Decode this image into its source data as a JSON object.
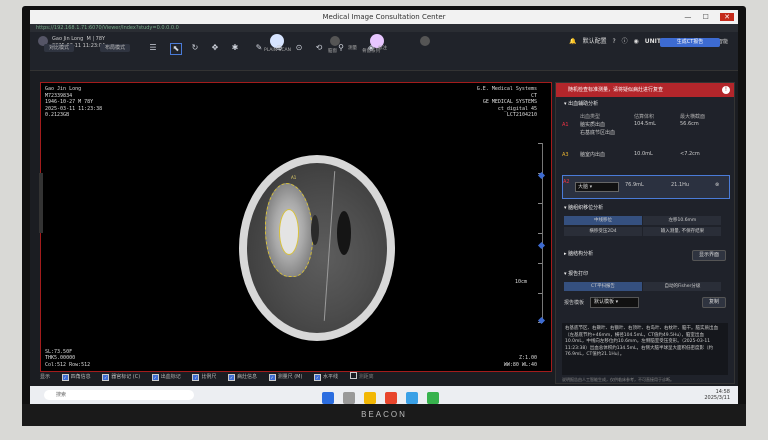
{
  "window": {
    "title": "Medical Image Consultation Center",
    "controls": [
      "—",
      "☐",
      "✕"
    ]
  },
  "address": {
    "url": "https://192.168.1.71:6070/Viewer/Index?study=0.0.0.0.0"
  },
  "patient": {
    "name": "Gao Jin Long",
    "sex_age": "M | 78Y",
    "date": "2025-03-11 11:23:04"
  },
  "series": [
    {
      "label": "PLAIN SCAN",
      "color": "#d6e4ff"
    },
    {
      "label": "脑窗",
      "color": "#555"
    },
    {
      "label": "骨窗系列",
      "color": "#e7c6ff"
    },
    {
      "label": "",
      "color": "#555"
    }
  ],
  "top_right": {
    "notif": "默认配置",
    "brand": "UNITED IMAGING",
    "brand_sub": "联影智能"
  },
  "top_action": "生成CT报告",
  "toolbar": {
    "tab_left": "对比模式",
    "tab_right": "布局模式",
    "tools": [
      {
        "icon": "list-icon",
        "glyph": "☰"
      },
      {
        "icon": "pointer-icon",
        "glyph": "⬉",
        "selected": true
      },
      {
        "icon": "rotate-icon",
        "glyph": "↻"
      },
      {
        "icon": "pan-icon",
        "glyph": "✥"
      },
      {
        "icon": "settings-icon",
        "glyph": "✱"
      },
      {
        "icon": "pen-icon",
        "glyph": "✎"
      },
      {
        "icon": "measure-icon",
        "glyph": "⊕"
      },
      {
        "icon": "zoom-icon",
        "glyph": "⊙"
      },
      {
        "icon": "reset-icon",
        "glyph": "⟲"
      },
      {
        "icon": "compare-icon",
        "glyph": "⚲"
      },
      {
        "icon": "window-icon",
        "glyph": "◈"
      }
    ],
    "tool_labels": [
      "测量",
      "标注"
    ]
  },
  "overlay": {
    "top_left": "Gao Jin Long\nM72339834\n1946-10-27 M 78Y\n2025-03-11 11:23:38\n0.2123GB",
    "top_right": "G.E. Medical Systems\nCT\nGE MEDICAL SYSTEMS\nct_digital 45\nLCT2104210",
    "bottom_left": "SL:73.50F\nTHK5.00000\nCol:512 Row:512",
    "bottom_right": "Z:1.00\nWW:80 WL:40",
    "scale_label": "10cm"
  },
  "viewer_checks": [
    {
      "label": "显示",
      "checked": false,
      "plain": true
    },
    {
      "label": "四角信息",
      "checked": true
    },
    {
      "label": "器官标记 (C)",
      "checked": true
    },
    {
      "label": "出血标记",
      "checked": true
    },
    {
      "label": "比例尺",
      "checked": true
    },
    {
      "label": "病灶信息",
      "checked": true
    },
    {
      "label": "测量尺 (M)",
      "checked": true
    },
    {
      "label": "水平线",
      "checked": true
    },
    {
      "label": "测距离",
      "checked": false
    }
  ],
  "panel": {
    "alert": "随机检查标准测量，请将疑似病灶进行复查",
    "sec1": "出血辅助分析",
    "cols": [
      "出血类型",
      "估算体积",
      "最大横截面"
    ],
    "rows": [
      {
        "tag": "A1",
        "a": "脑实质出血",
        "b": "104.5mL",
        "c": "56.6cm"
      },
      {
        "tag": "A2",
        "a": "右基底节区出血",
        "b": "",
        "c": ""
      },
      {
        "tag": "A3",
        "a": "脑室内出血",
        "b": "10.0mL",
        "c": "<7.2cm"
      },
      {
        "tag": "A2",
        "a": "大脑",
        "b": "76.9mL",
        "c": "21.1Hu",
        "highlight": true
      }
    ],
    "sec2": "脑组织移位分析",
    "grid": [
      "中线移位",
      "左移10.6mm",
      "横移受压2D4",
      "输入测量, 不保存结果"
    ],
    "sec3": "脑结构分析",
    "sec3_btn": "显示界面",
    "sec4": "报告打印",
    "grid2": [
      "CT平扫报告",
      "自动的Fisher分级"
    ],
    "template_label": "报告模板",
    "template_value": "默认模板",
    "copy_btn": "复制",
    "report": "右基底节区、右颞叶、右额叶、右顶叶、右岛叶、右枕叶、脑干。脑实质出血（左基底节约+46mm，横径104.5mL，CT值约49.5Hu），脑室出血10.0mL，中线向左移位约10.6mm，左侧脑室受压变形。（2025-03-11 11:23:38）出血总体积约134.5mL，右侧大脑半球呈大面积低密度影（约76.9mL，CT值约21.1Hu）。",
    "footer": "说明报告由人工智能生成，仅供临床参考，不可直接用于诊断。"
  },
  "taskbar": {
    "search": "搜索",
    "time": "14:58",
    "date": "2025/3/11"
  },
  "monitor": {
    "brand": "BEACON"
  }
}
